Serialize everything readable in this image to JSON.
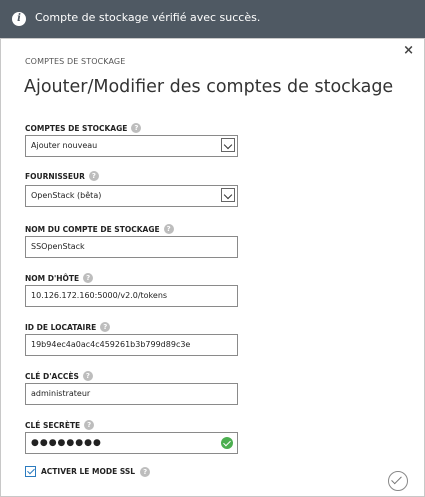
{
  "notification": {
    "icon": "info-icon",
    "message": "Compte de stockage vérifié avec succès."
  },
  "dialog": {
    "close_label": "×",
    "subtitle": "COMPTES DE STOCKAGE",
    "title": "Ajouter/Modifier des comptes de stockage"
  },
  "fields": {
    "storage_accounts": {
      "label": "COMPTES DE STOCKAGE",
      "value": "Ajouter nouveau"
    },
    "provider": {
      "label": "FOURNISSEUR",
      "value": "OpenStack (bêta)"
    },
    "account_name": {
      "label": "NOM DU COMPTE DE STOCKAGE",
      "value": "SSOpenStack"
    },
    "hostname": {
      "label": "NOM D'HÔTE",
      "value": "10.126.172.160:5000/v2.0/tokens"
    },
    "tenant_id": {
      "label": "ID DE LOCATAIRE",
      "value": "19b94ec4a0ac4c459261b3b799d89c3e"
    },
    "access_key": {
      "label": "CLÉ D'ACCÈS",
      "value": "administrateur"
    },
    "secret_key": {
      "label": "CLÉ SECRÈTE",
      "value": "●●●●●●●●"
    }
  },
  "ssl": {
    "label": "ACTIVER LE MODE SSL",
    "checked": true
  },
  "help_glyph": "?",
  "colors": {
    "notification_bg": "#4f5963",
    "accent": "#2b7bbf",
    "success": "#4caf50"
  }
}
